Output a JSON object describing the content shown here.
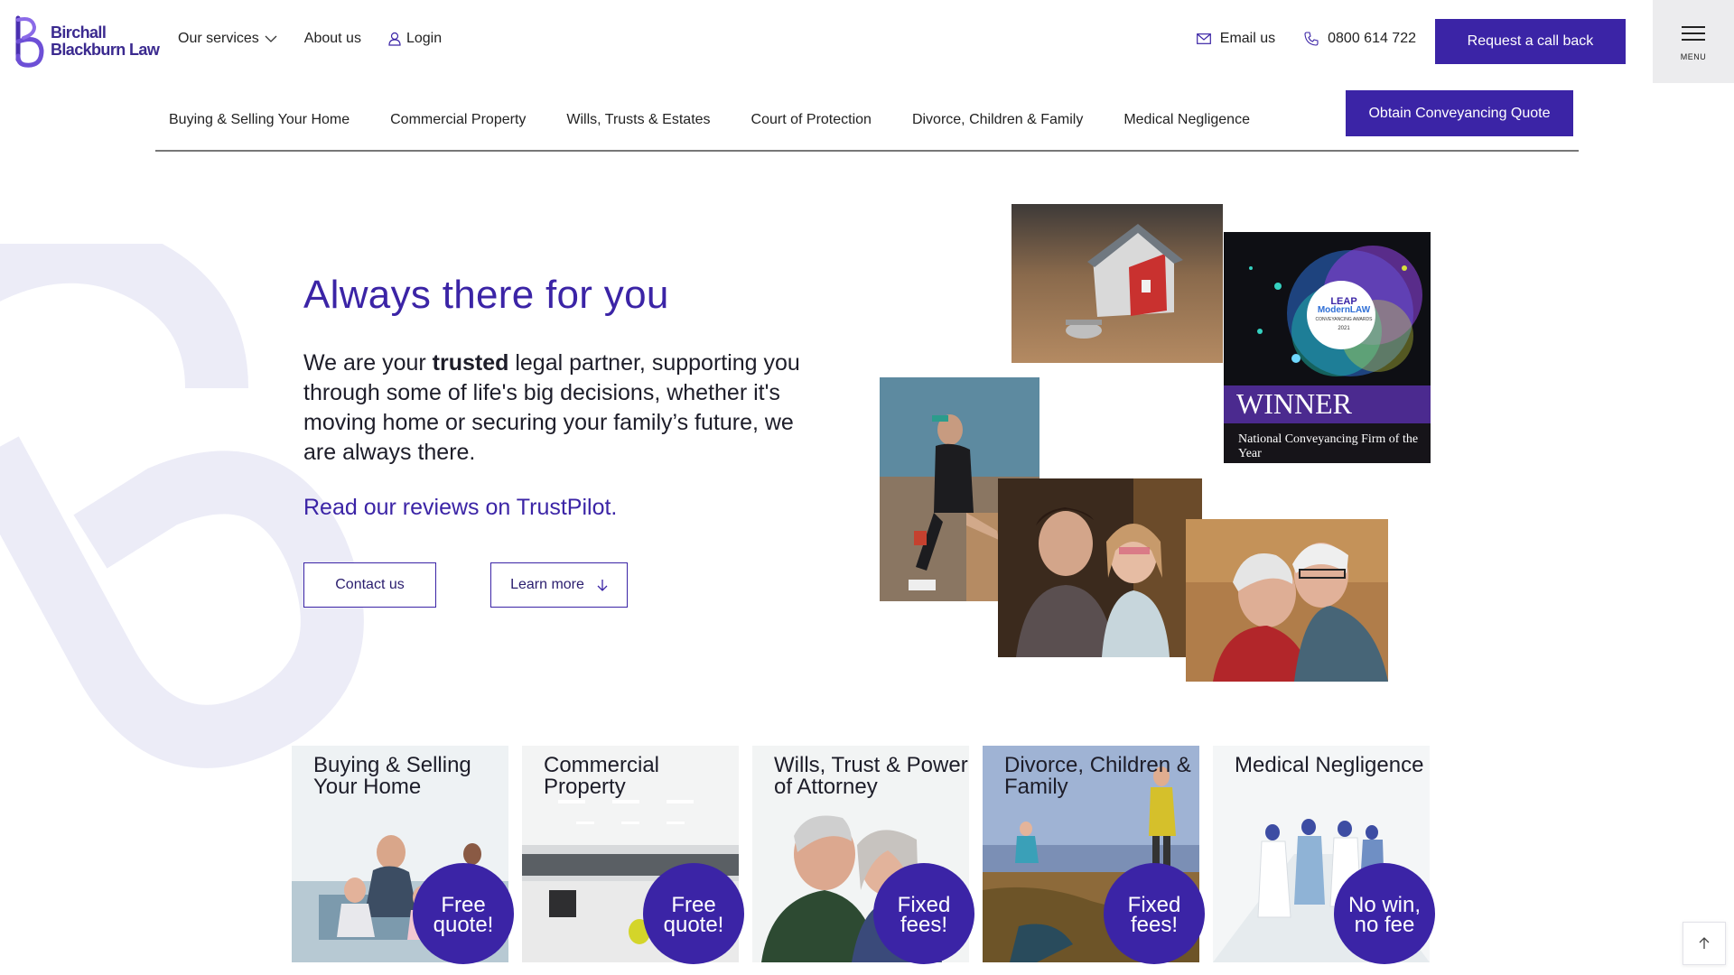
{
  "brand": {
    "name_line1": "Birchall",
    "name_line2": "Blackburn Law",
    "accent": "#3b24a6"
  },
  "topnav": {
    "services": "Our services",
    "about": "About us",
    "login": "Login"
  },
  "contact": {
    "email": "Email us",
    "phone": "0800 614 722",
    "callback": "Request a call back",
    "menu": "MENU"
  },
  "service_nav": {
    "items": [
      "Buying & Selling Your Home",
      "Commercial Property",
      "Wills, Trusts & Estates",
      "Court of Protection",
      "Divorce, Children & Family",
      "Medical Negligence"
    ],
    "quote": "Obtain Conveyancing Quote"
  },
  "hero": {
    "title": "Always there for you",
    "intro_before": "We are your ",
    "intro_bold": "trusted",
    "intro_after": " legal partner, supporting you through some of life's big decisions, whether it's moving home or securing your family’s future, we are always there.",
    "reviews": "Read our reviews on TrustPilot.",
    "contact_btn": "Contact us",
    "learn_btn": "Learn more"
  },
  "award": {
    "badge_line1": "LEAP",
    "badge_line2": "ModernLAW",
    "badge_line3": "CONVEYANCING AWARDS",
    "badge_year": "2021",
    "winner": "WINNER",
    "caption": "National Conveyancing Firm of the Year"
  },
  "cards": [
    {
      "title": "Buying & Selling Your Home",
      "badge": "Free quote!"
    },
    {
      "title": "Commercial Property",
      "badge": "Free quote!"
    },
    {
      "title": "Wills, Trust & Power of Attorney",
      "badge": "Fixed fees!"
    },
    {
      "title": "Divorce, Children & Family",
      "badge": "Fixed fees!"
    },
    {
      "title": "Medical Negligence",
      "badge": "No win, no fee"
    }
  ],
  "icons": {
    "logo": "b-logo-icon",
    "chevron": "chevron-down-icon",
    "user": "user-icon",
    "mail": "mail-icon",
    "phone": "phone-icon",
    "menu": "hamburger-icon",
    "arrow_down": "arrow-down-icon",
    "arrow_up": "arrow-up-icon"
  }
}
